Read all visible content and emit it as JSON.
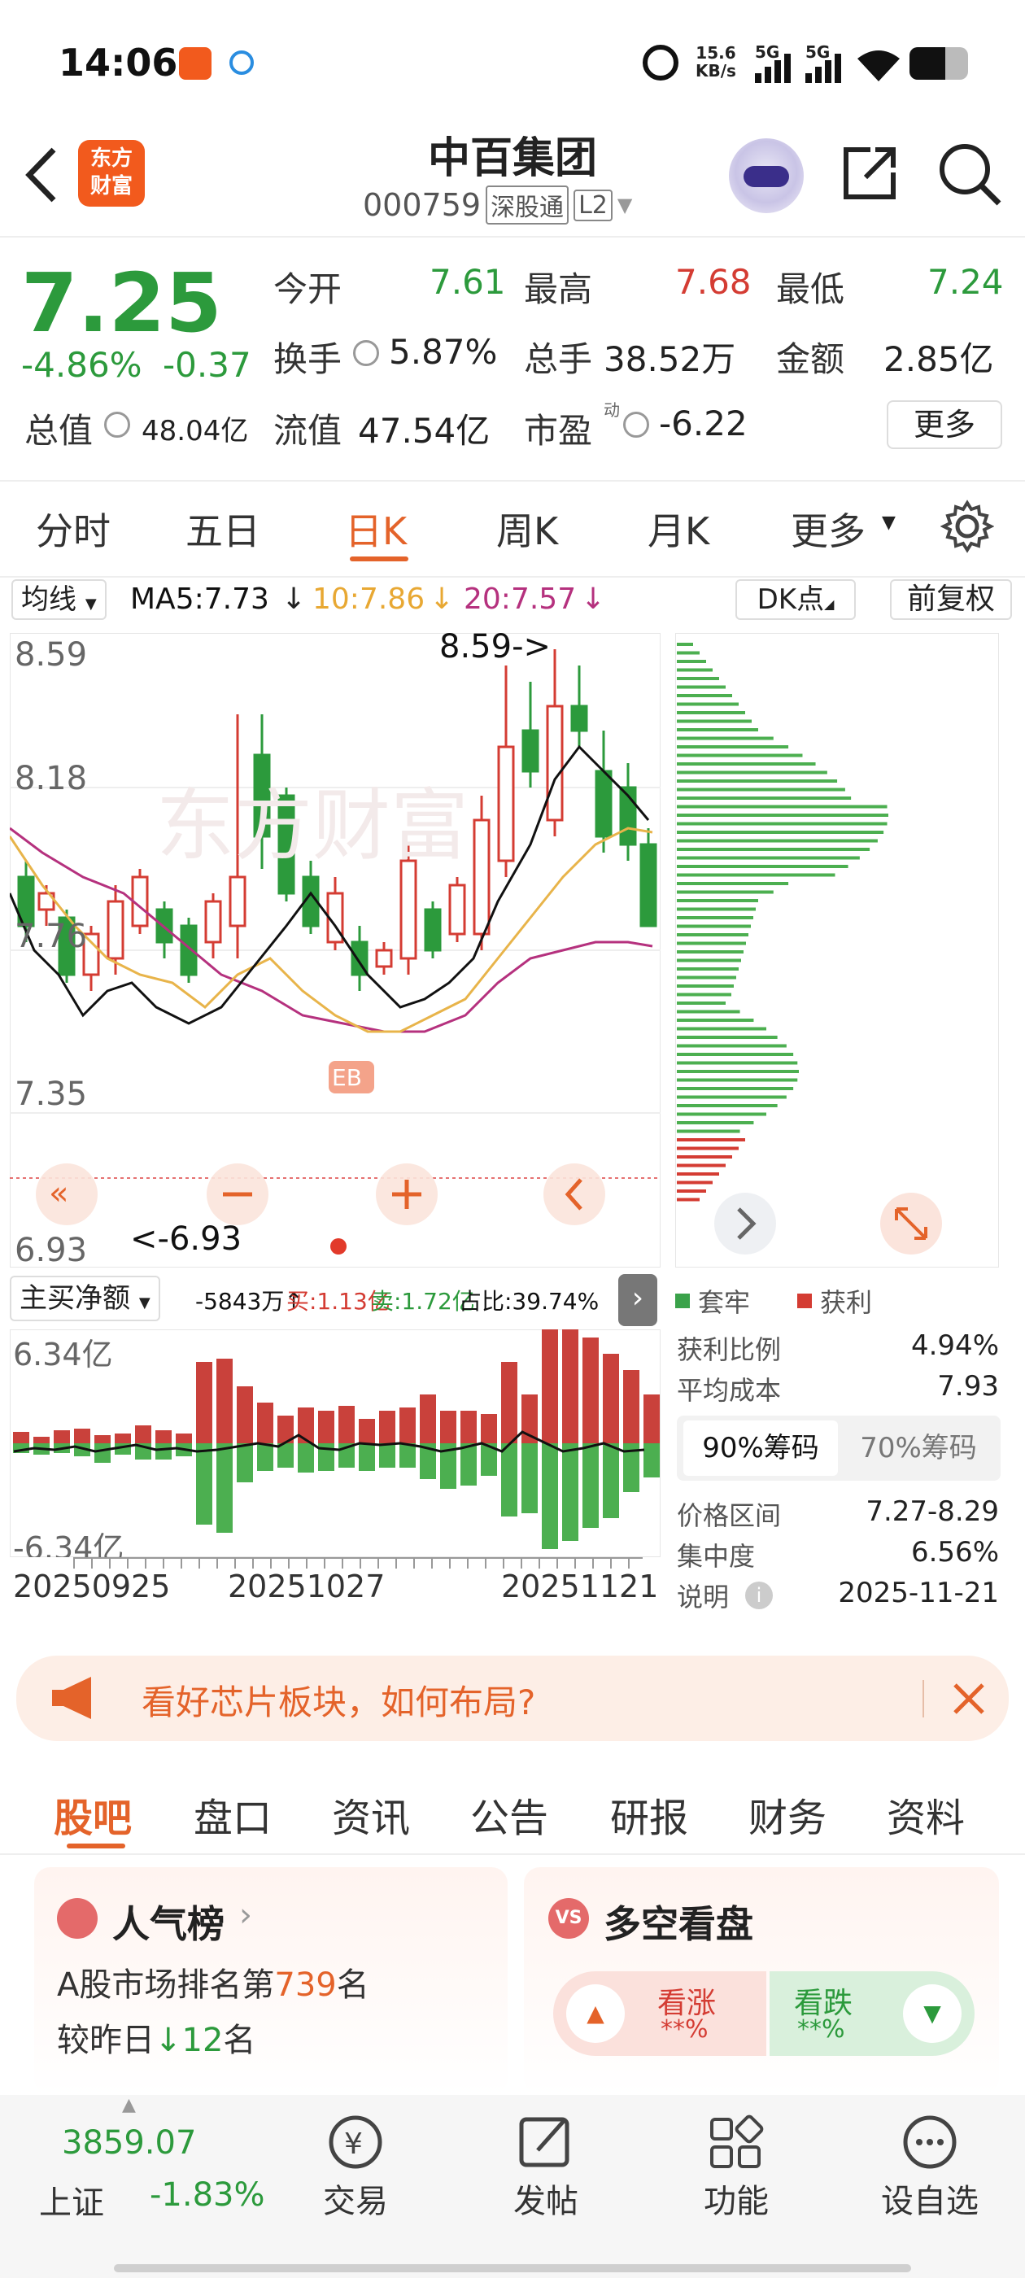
{
  "status": {
    "time": "14:06",
    "net_speed_value": "15.6",
    "net_speed_unit": "KB/s",
    "sig1": "5G",
    "sig2": "5G"
  },
  "header": {
    "logo_line1": "东方",
    "logo_line2": "财富",
    "name": "中百集团",
    "code": "000759",
    "tag1": "深股通",
    "tag2": "L2"
  },
  "quote": {
    "price": "7.25",
    "change_pct": "-4.86%",
    "change": "-0.37",
    "open_label": "今开",
    "open": "7.61",
    "high_label": "最高",
    "high": "7.68",
    "low_label": "最低",
    "low": "7.24",
    "turnover_label": "换手",
    "turnover": "5.87%",
    "volume_label": "总手",
    "volume": "38.52万",
    "amount_label": "金额",
    "amount": "2.85亿",
    "mcap_label": "总值",
    "mcap": "48.04亿",
    "float_label": "流值",
    "float": "47.54亿",
    "pe_label": "市盈",
    "pe_sup": "动",
    "pe": "-6.22",
    "more": "更多"
  },
  "tabs": [
    "分时",
    "五日",
    "日K",
    "周K",
    "月K",
    "更多"
  ],
  "indicator": {
    "ma_btn": "均线",
    "ma5": "MA5:7.73",
    "ma10": "10:7.86",
    "ma20": "20:7.57",
    "dk": "DK点",
    "fq": "前复权"
  },
  "kline": {
    "y_labels": [
      "8.59",
      "8.18",
      "7.76",
      "7.35",
      "6.93"
    ],
    "high_note": "8.59->",
    "low_note": "<-6.93",
    "watermark": "东方财富"
  },
  "flow": {
    "select": "主买净额",
    "net": "-5843万",
    "buy": "买:1.13亿",
    "sell": "卖:1.72亿",
    "ratio": "占比:39.74%",
    "top": "6.34亿",
    "bottom": "-6.34亿",
    "dates": [
      "20250925",
      "20251027",
      "20251121"
    ]
  },
  "chips": {
    "legend_trap": "套牢",
    "legend_profit": "获利",
    "profit_ratio_label": "获利比例",
    "profit_ratio": "4.94%",
    "avg_cost_label": "平均成本",
    "avg_cost": "7.93",
    "tab90": "90%筹码",
    "tab70": "70%筹码",
    "range_label": "价格区间",
    "range": "7.27-8.29",
    "conc_label": "集中度",
    "conc": "6.56%",
    "note_label": "说明",
    "note": "2025-11-21"
  },
  "banner": {
    "text": "看好芯片板块，如何布局?"
  },
  "subtabs": [
    "股吧",
    "盘口",
    "资讯",
    "公告",
    "研报",
    "财务",
    "资料"
  ],
  "cards": {
    "pop_title": "人气榜",
    "pop_line1a": "A股市场排名第",
    "pop_rank": "739",
    "pop_line1b": "名",
    "pop_line2a": "较昨日",
    "pop_change": "12",
    "pop_line2b": "名",
    "vs_title": "多空看盘",
    "vs_up": "看涨",
    "vs_up_pct": "**%",
    "vs_down": "看跌",
    "vs_down_pct": "**%"
  },
  "bottom": {
    "index_value": "3859.07",
    "index_name": "上证",
    "index_change": "-1.83%",
    "nav": [
      "交易",
      "发帖",
      "功能",
      "设自选"
    ]
  }
}
